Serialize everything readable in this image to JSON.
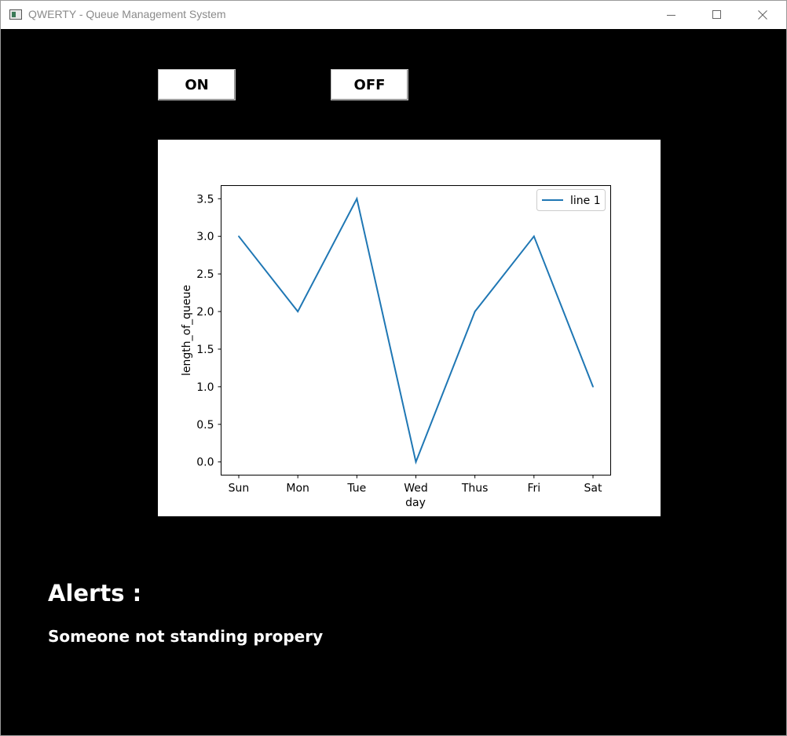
{
  "window": {
    "title": "QWERTY - Queue Management System"
  },
  "controls": {
    "on_label": "ON",
    "off_label": "OFF"
  },
  "alerts": {
    "heading": "Alerts :",
    "message": "Someone not standing propery"
  },
  "chart_data": {
    "type": "line",
    "categories": [
      "Sun",
      "Mon",
      "Tue",
      "Wed",
      "Thus",
      "Fri",
      "Sat"
    ],
    "series": [
      {
        "name": "line 1",
        "values": [
          3.0,
          2.0,
          3.5,
          0.0,
          2.0,
          3.0,
          1.0
        ],
        "color": "#1f77b4"
      }
    ],
    "xlabel": "day",
    "ylabel": "length_of_queue",
    "ylim": [
      -0.175,
      3.675
    ],
    "yticks": [
      0.0,
      0.5,
      1.0,
      1.5,
      2.0,
      2.5,
      3.0,
      3.5
    ],
    "legend": "top-right",
    "grid": false
  }
}
